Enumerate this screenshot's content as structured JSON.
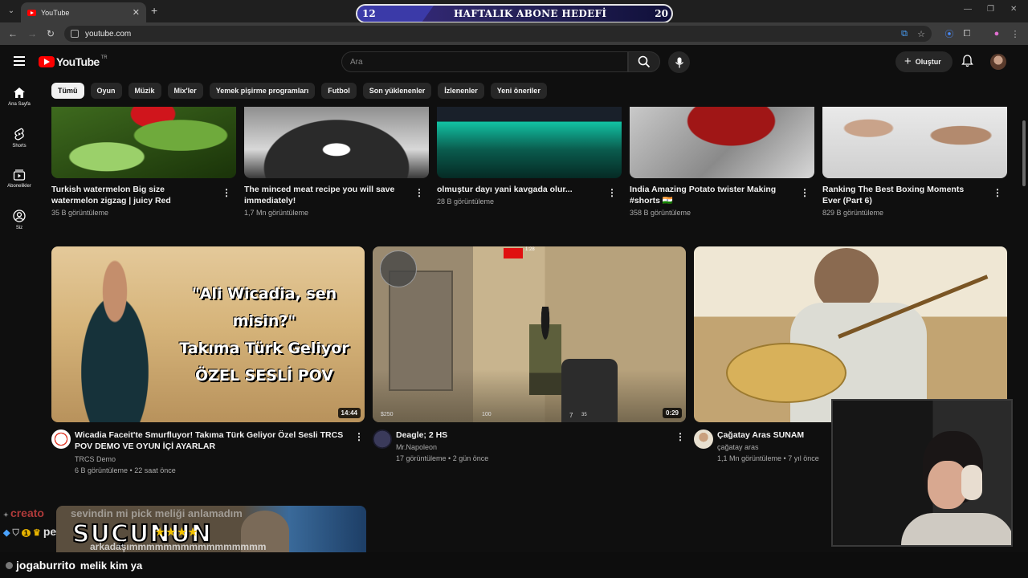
{
  "browser": {
    "tab_title": "YouTube",
    "url": "youtube.com"
  },
  "goal_overlay": {
    "current": "12",
    "title": "HAFTALIK ABONE HEDEFİ",
    "target": "20"
  },
  "header": {
    "logo_text": "YouTube",
    "country_code": "TR",
    "search_placeholder": "Ara",
    "create_label": "Oluştur"
  },
  "guide": [
    {
      "label": "Ana Sayfa",
      "icon": "home-icon"
    },
    {
      "label": "Shorts",
      "icon": "shorts-icon"
    },
    {
      "label": "Abonelikler",
      "icon": "subscriptions-icon"
    },
    {
      "label": "Siz",
      "icon": "you-icon"
    }
  ],
  "chips": [
    "Tümü",
    "Oyun",
    "Müzik",
    "Mix'ler",
    "Yemek pişirme programları",
    "Futbol",
    "Son yüklenenler",
    "İzlenenler",
    "Yeni öneriler"
  ],
  "row1": [
    {
      "title": "Turkish watermelon Big size watermelon zigzag | juicy Red",
      "views": "35 B görüntüleme"
    },
    {
      "title": "The minced meat recipe you will save immediately!",
      "views": "1,7 Mn görüntüleme"
    },
    {
      "title": "olmuştur dayı yani kavgada olur...",
      "views": "28 B görüntüleme"
    },
    {
      "title": "India Amazing Potato twister Making #shorts 🇮🇳",
      "views": "358 B görüntüleme"
    },
    {
      "title": "Ranking The Best Boxing Moments Ever (Part 6)",
      "views": "829 B görüntüleme"
    }
  ],
  "row2": [
    {
      "title": "Wicadia Faceit'te Smurfluyor! Takıma Türk Geliyor  Özel Sesli TRCS POV DEMO VE OYUN İÇİ AYARLAR",
      "channel": "TRCS Demo",
      "meta": "6 B görüntüleme • 22 saat önce",
      "duration": "14:44",
      "thumb_text": [
        "\"Ali Wicadia, sen misin?\"",
        "Takıma Türk Geliyor",
        "ÖZEL SESLİ POV"
      ]
    },
    {
      "title": "Deagle; 2 HS",
      "channel": "Mr.Napoleon",
      "meta": "17 görüntüleme • 2 gün önce",
      "duration": "0:29",
      "hud_money": "$250",
      "hud_ammo": "7",
      "hud_reserve": "35",
      "hud_armor": "100",
      "hud_timer": "1:28"
    },
    {
      "title": "Çağatay Aras SUNAM",
      "channel": "çağatay aras",
      "meta": "1,1 Mn görüntüleme • 7 yıl önce"
    }
  ],
  "overlay_chat": {
    "line1_user": "creato",
    "line1_text": "sevindin mi pick meliği anlamadım",
    "line2_prefix": "pe",
    "line3_text": "arkadaşımmmmmmmmmmmmmmmm",
    "thumb_text": "SUÇUNUN"
  },
  "bottom_chat": {
    "user": "jogaburrito",
    "message": "melik kim ya"
  },
  "colors": {
    "background": "#0f0f0f",
    "brand_red": "#ff0000",
    "goal_purple": "#3b3aa8"
  }
}
